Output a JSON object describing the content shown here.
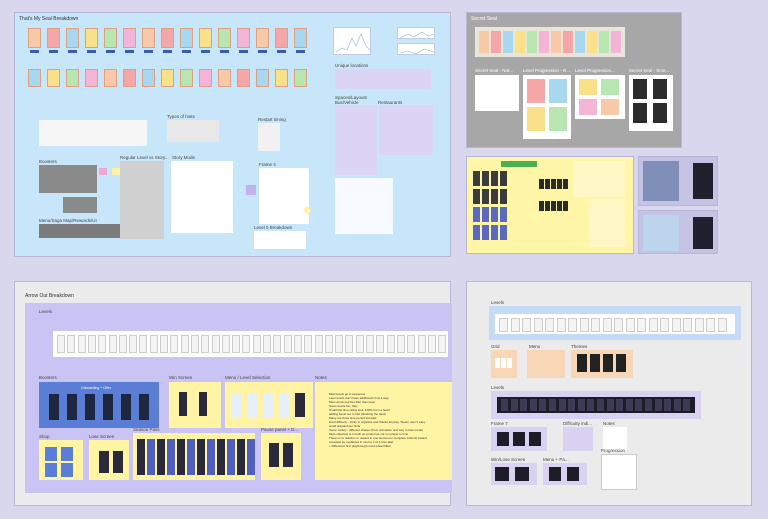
{
  "canvas": {
    "background": "#d9d7ee"
  },
  "frames": {
    "seal": {
      "title": "That's My Seal Breakdown",
      "labels": {
        "unique_locations": "Unique locations",
        "spaces_layouts": "Spaces/Layouts",
        "bus_vehicle": "Bus/Vehicle",
        "restaurants": "Restaurants",
        "types_of_hints": "Types of hints",
        "restart_timing": "Restart timing",
        "boosters": "Boosters",
        "regular_level": "Regular Level vs Story...",
        "story_mode": "Story Mode",
        "frame4": "Frame 4",
        "menu": "Menu/Saga Map/Rewards/UI",
        "level_breakdown": "Level 5 Breakdown"
      },
      "colors": {
        "bg": "#c8e6f9",
        "sticky": "#fff4a3",
        "purple": "#dcd4f4"
      }
    },
    "secret": {
      "title": "Secret Seal",
      "sub": [
        "Secret Seal - Not...",
        "Level Progression - R...",
        "Level Progression...",
        "Secret Seal - Scre..."
      ],
      "colors": {
        "bg": "#a7a7a7"
      }
    },
    "yellow": {
      "colors": {
        "bg": "#fef6a6"
      }
    },
    "arrow": {
      "title": "Arrow Out Breakdown",
      "labels": {
        "levels": "Levels",
        "boosters": "Boosters",
        "win_screen": "Win Screen",
        "menu_level": "Menu / Level Selection",
        "notes": "Notes",
        "shop": "Shop",
        "lose_screen": "Lose Screen",
        "season_pass": "Season Pass",
        "pause": "Pause panel + D..."
      },
      "boosters_banner": "Onboarding + Offer",
      "notes_lines": [
        "Most levels go in sequence",
        "Later levels don't have additional UI at a way",
        "Most arrow puzzles filler than level",
        "Some levels fun, they",
        "Small first time rating look, 100% from a heart",
        "adding boost out to fast (finishing the hard)",
        "Many are three time period forecast",
        "Hard difficulty - tricky to organize and thanks anyway. Steam user if easy",
        "small onboard per hints",
        "Some variety - different shapes (from animation and way to lose mode)",
        "Most objective is to both an arrow has not run player in time",
        "There is no reaction or reward in one element to complete submits Inward",
        "complete be explained in next to 4 of 4 time later",
        "+ Difference first playthrough most wheel filled"
      ],
      "colors": {
        "bg": "#ebebeb",
        "sticky": "#fff4a3",
        "blue": "#5a7ed6",
        "purple": "#c9c4f3"
      }
    },
    "right": {
      "labels": {
        "levels_top": "Levels",
        "grid": "Grid",
        "menu": "Menu",
        "themes": "Themes",
        "levels_mid": "Levels",
        "frame7": "Frame 7",
        "difficulty": "Difficulty indi...",
        "notes": "Notes",
        "win_lose": "Win/Lose Screen",
        "menu_pa": "Menu + Pa...",
        "progression": "Progression"
      },
      "colors": {
        "bg": "#ebebeb",
        "blue": "#c5daf7",
        "peach": "#f8d6b6",
        "purple": "#d9d1f2"
      }
    }
  }
}
